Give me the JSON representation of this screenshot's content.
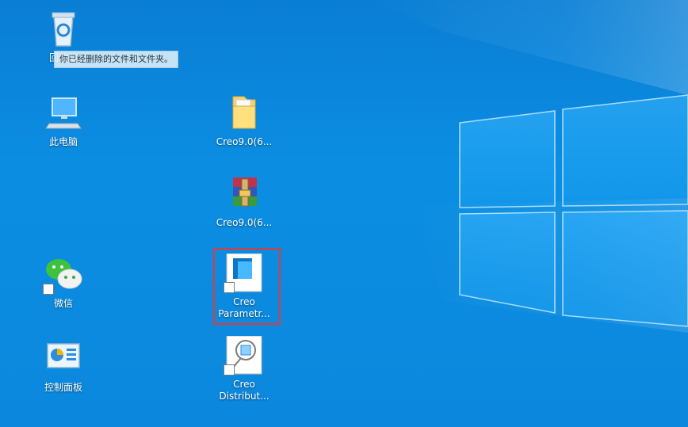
{
  "desktop": {
    "icons": [
      {
        "label": "回收站",
        "icon": "recycle-bin-icon"
      },
      {
        "label": "此电脑",
        "icon": "computer-icon"
      },
      {
        "label": "微信",
        "icon": "wechat-icon"
      },
      {
        "label": "控制面板",
        "icon": "control-panel-icon"
      },
      {
        "label": "Creo9.0(6...",
        "icon": "folder-icon"
      },
      {
        "label": "Creo9.0(6...",
        "icon": "winrar-archive-icon"
      },
      {
        "label": "Creo\nParametr...",
        "icon": "creo-parametric-icon",
        "selected": true
      },
      {
        "label": "Creo\nDistribut...",
        "icon": "creo-distributed-icon"
      }
    ],
    "tooltip": "你已经删除的文件和文件夹。"
  },
  "colors": {
    "background": "#0b8ee2",
    "selection_outline": "#e03a3a"
  }
}
